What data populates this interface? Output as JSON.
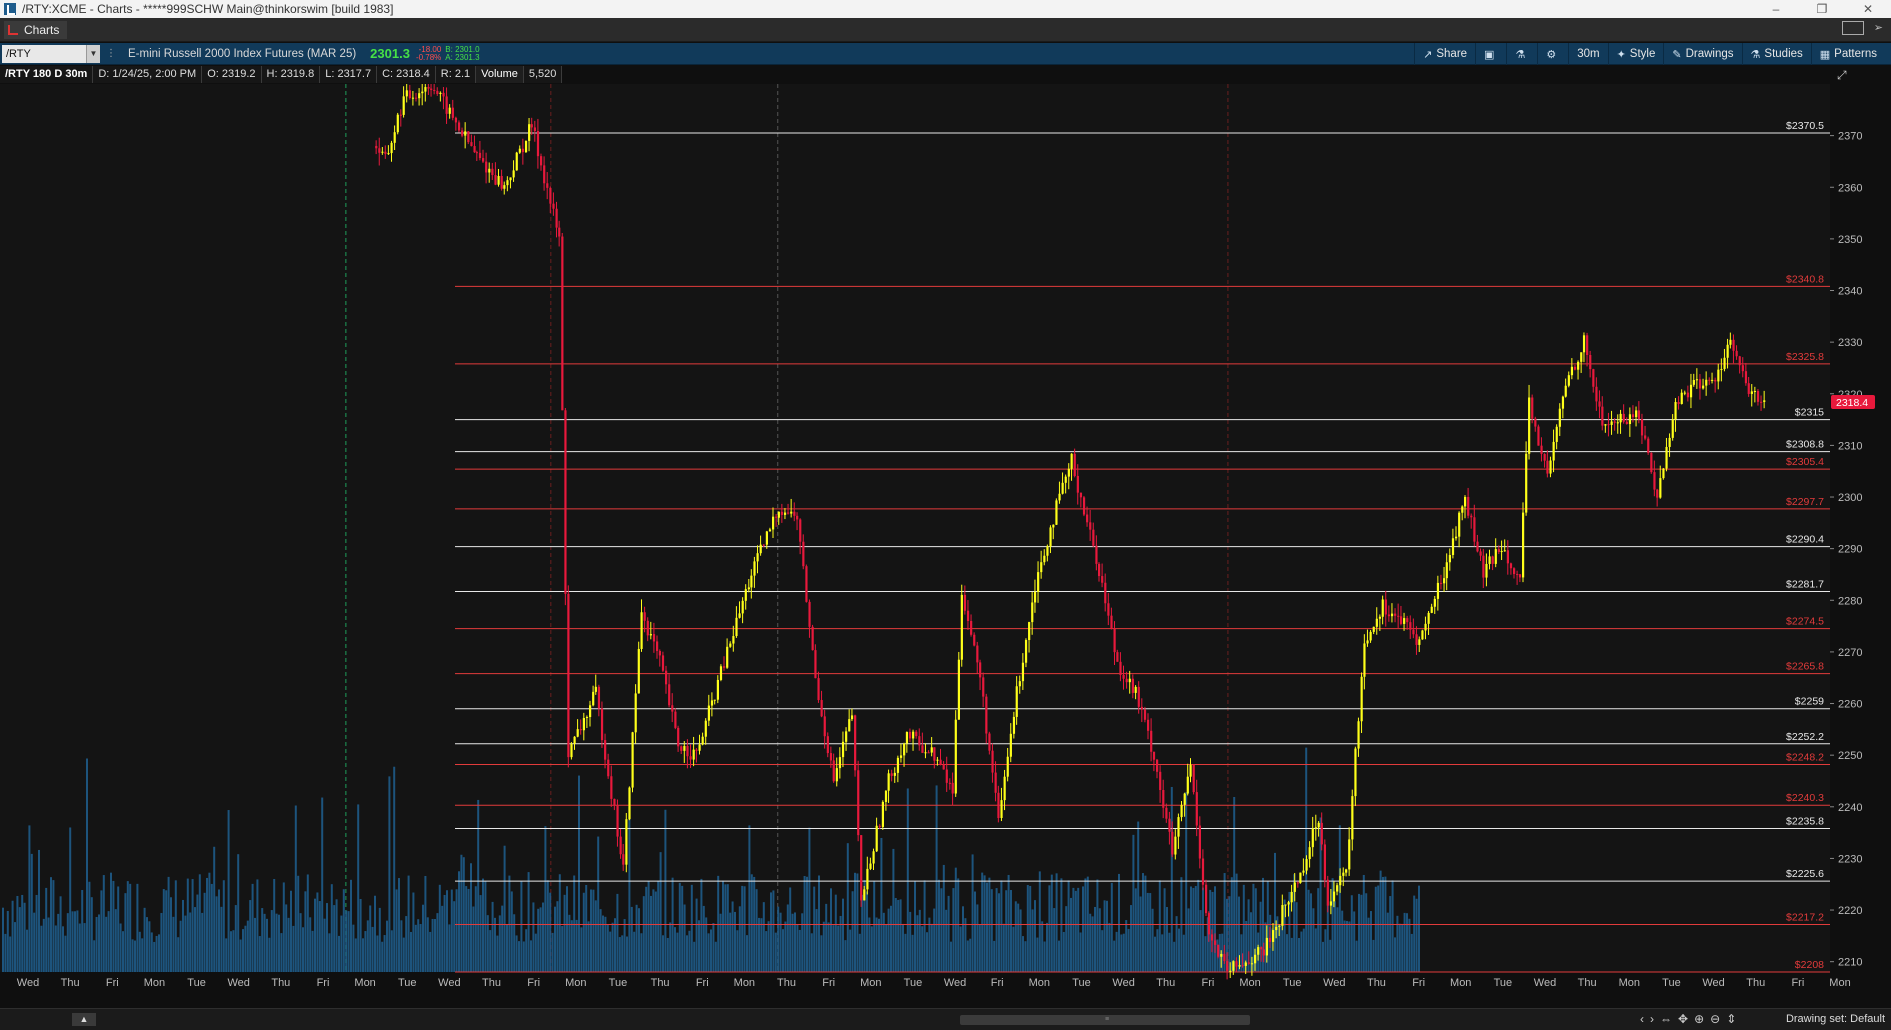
{
  "window": {
    "title": "/RTY:XCME - Charts - *****999SCHW Main@thinkorswim [build 1983]",
    "min_glyph": "–",
    "max_glyph": "❐",
    "close_glyph": "✕"
  },
  "tabs": [
    {
      "label": "Charts"
    }
  ],
  "toolbar": {
    "symbol": "/RTY",
    "description": "E-mini Russell 2000 Index Futures (MAR 25)",
    "last_price": "2301.3",
    "change": "-18.00",
    "change_pct": "-0.78%",
    "bid": "B: 2301.0",
    "ask": "A: 2301.3",
    "share": "Share",
    "timeframe": "30m",
    "style": "Style",
    "drawings": "Drawings",
    "studies": "Studies",
    "patterns": "Patterns"
  },
  "info": {
    "title": "/RTY 180 D 30m",
    "date": "D: 1/24/25, 2:00 PM",
    "open": "O: 2319.2",
    "high": "H: 2319.8",
    "low": "L: 2317.7",
    "close": "C: 2318.4",
    "range": "R: 2.1",
    "volume_label": "Volume",
    "volume_value": "5,520"
  },
  "alert_glyph": "!",
  "bottom": {
    "drawing_set": "Drawing set: Default"
  },
  "colors": {
    "up": "#ffff1a",
    "down": "#e8193c",
    "volume": "#1f5f8f",
    "level_white": "#e8e8e8",
    "level_red": "#e23b3b",
    "current_price_bg": "#e8193c"
  },
  "chart_data": {
    "type": "candlestick",
    "ylim": [
      2208,
      2380
    ],
    "y_ticks": [
      2210,
      2220,
      2230,
      2240,
      2250,
      2260,
      2270,
      2280,
      2290,
      2300,
      2310,
      2320,
      2330,
      2340,
      2350,
      2360,
      2370
    ],
    "current_price": "2318.4",
    "x_ticks": [
      "Wed",
      "Thu",
      "Fri",
      "Mon",
      "Tue",
      "Wed",
      "Thu",
      "Fri",
      "Mon",
      "Tue",
      "Wed",
      "Thu",
      "Fri",
      "Mon",
      "Tue",
      "Thu",
      "Fri",
      "Mon",
      "Thu",
      "Fri",
      "Mon",
      "Tue",
      "Wed",
      "Fri",
      "Mon",
      "Tue",
      "Wed",
      "Thu",
      "Fri",
      "Mon",
      "Tue",
      "Wed",
      "Thu",
      "Fri",
      "Mon",
      "Tue",
      "Wed",
      "Thu",
      "Mon",
      "Tue",
      "Wed",
      "Thu",
      "Fri",
      "Mon"
    ],
    "levels": [
      {
        "label": "$2370.5",
        "value": 2370.5,
        "color": "white"
      },
      {
        "label": "$2340.8",
        "value": 2340.8,
        "color": "red"
      },
      {
        "label": "$2325.8",
        "value": 2325.8,
        "color": "red"
      },
      {
        "label": "$2315",
        "value": 2315,
        "color": "white"
      },
      {
        "label": "$2308.8",
        "value": 2308.8,
        "color": "white"
      },
      {
        "label": "$2305.4",
        "value": 2305.4,
        "color": "red"
      },
      {
        "label": "$2297.7",
        "value": 2297.7,
        "color": "red"
      },
      {
        "label": "$2290.4",
        "value": 2290.4,
        "color": "white"
      },
      {
        "label": "$2281.7",
        "value": 2281.7,
        "color": "white"
      },
      {
        "label": "$2274.5",
        "value": 2274.5,
        "color": "red"
      },
      {
        "label": "$2265.8",
        "value": 2265.8,
        "color": "red"
      },
      {
        "label": "$2259",
        "value": 2259,
        "color": "white"
      },
      {
        "label": "$2252.2",
        "value": 2252.2,
        "color": "white"
      },
      {
        "label": "$2248.2",
        "value": 2248.2,
        "color": "red"
      },
      {
        "label": "$2240.3",
        "value": 2240.3,
        "color": "red"
      },
      {
        "label": "$2235.8",
        "value": 2235.8,
        "color": "white"
      },
      {
        "label": "$2225.6",
        "value": 2225.6,
        "color": "white"
      },
      {
        "label": "$2217.2",
        "value": 2217.2,
        "color": "red"
      },
      {
        "label": "$2208",
        "value": 2208,
        "color": "red"
      }
    ],
    "path_anchors": [
      [
        0.205,
        2368
      ],
      [
        0.21,
        2365
      ],
      [
        0.22,
        2377
      ],
      [
        0.235,
        2380
      ],
      [
        0.26,
        2366
      ],
      [
        0.275,
        2360
      ],
      [
        0.29,
        2372
      ],
      [
        0.305,
        2350
      ],
      [
        0.31,
        2250
      ],
      [
        0.325,
        2262
      ],
      [
        0.34,
        2228
      ],
      [
        0.35,
        2278
      ],
      [
        0.36,
        2268
      ],
      [
        0.37,
        2252
      ],
      [
        0.38,
        2250
      ],
      [
        0.39,
        2262
      ],
      [
        0.41,
        2285
      ],
      [
        0.425,
        2298
      ],
      [
        0.435,
        2296
      ],
      [
        0.445,
        2265
      ],
      [
        0.455,
        2245
      ],
      [
        0.465,
        2258
      ],
      [
        0.47,
        2222
      ],
      [
        0.485,
        2245
      ],
      [
        0.495,
        2254
      ],
      [
        0.51,
        2250
      ],
      [
        0.52,
        2243
      ],
      [
        0.525,
        2282
      ],
      [
        0.535,
        2265
      ],
      [
        0.545,
        2237
      ],
      [
        0.555,
        2262
      ],
      [
        0.565,
        2283
      ],
      [
        0.575,
        2296
      ],
      [
        0.585,
        2307
      ],
      [
        0.6,
        2286
      ],
      [
        0.61,
        2268
      ],
      [
        0.62,
        2262
      ],
      [
        0.63,
        2250
      ],
      [
        0.64,
        2231
      ],
      [
        0.65,
        2248
      ],
      [
        0.66,
        2215
      ],
      [
        0.67,
        2208
      ],
      [
        0.69,
        2212
      ],
      [
        0.71,
        2227
      ],
      [
        0.72,
        2238
      ],
      [
        0.725,
        2222
      ],
      [
        0.735,
        2227
      ],
      [
        0.745,
        2272
      ],
      [
        0.755,
        2279
      ],
      [
        0.765,
        2276
      ],
      [
        0.775,
        2272
      ],
      [
        0.79,
        2287
      ],
      [
        0.8,
        2300
      ],
      [
        0.81,
        2285
      ],
      [
        0.82,
        2291
      ],
      [
        0.83,
        2284
      ],
      [
        0.835,
        2318
      ],
      [
        0.845,
        2304
      ],
      [
        0.855,
        2322
      ],
      [
        0.865,
        2330
      ],
      [
        0.875,
        2314
      ],
      [
        0.885,
        2315
      ],
      [
        0.895,
        2316
      ],
      [
        0.905,
        2300
      ],
      [
        0.915,
        2318
      ],
      [
        0.925,
        2322
      ],
      [
        0.935,
        2322
      ],
      [
        0.945,
        2330
      ],
      [
        0.955,
        2320
      ],
      [
        0.965,
        2318.4
      ]
    ]
  }
}
